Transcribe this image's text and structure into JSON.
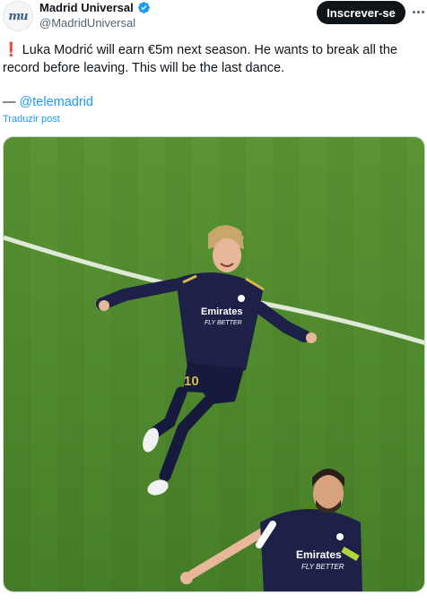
{
  "account": {
    "avatar_text": "mu",
    "display_name": "Madrid Universal",
    "handle": "@MadridUniversal",
    "verified_icon": "verified-badge-icon",
    "verified_color": "#1d9bf0"
  },
  "actions": {
    "subscribe_label": "Inscrever-se",
    "more_icon": "more-options-icon"
  },
  "tweet": {
    "lead_icon": "red-exclamation-icon",
    "text": "Luka Modrić will earn €5m next season. He wants to break all the record before leaving. This will be the last dance.",
    "credit_prefix": "— ",
    "credit_mention": "@telemadrid",
    "translate_label": "Traduzir post"
  },
  "media": {
    "description_icon": "photo-icon",
    "shirt_text_1": "Emirates",
    "shirt_text_2": "FLY BETTER",
    "shirt_number": "10",
    "pitch_color": "#4f8a2e",
    "kit_color": "#1d2148"
  },
  "colors": {
    "link": "#1d9bf0",
    "text": "#0f1419",
    "secondary": "#536471",
    "button": "#0f1419"
  }
}
